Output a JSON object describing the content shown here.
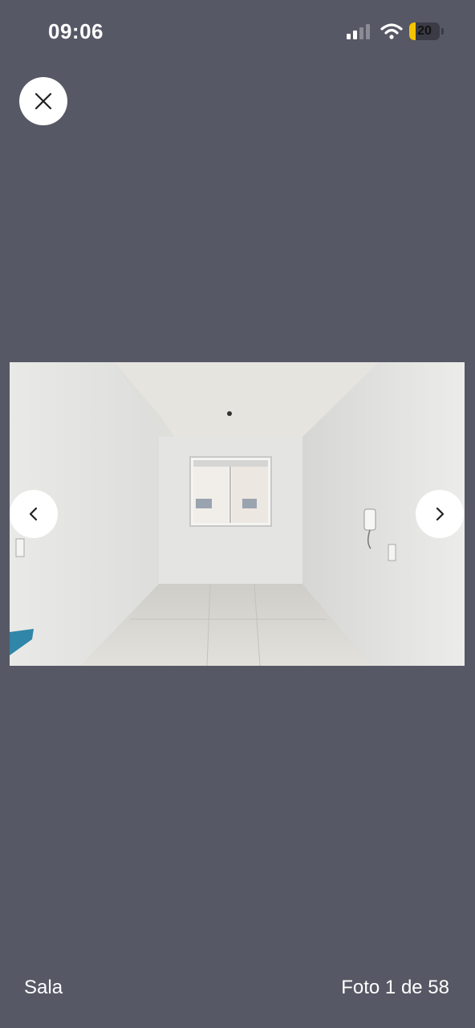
{
  "status_bar": {
    "time": "09:06",
    "battery_level": "20",
    "battery_color": "#f5c400",
    "icons": [
      "signal-icon",
      "wifi-icon",
      "battery-icon"
    ]
  },
  "viewer": {
    "background_color": "#575865",
    "close_icon": "close-icon",
    "prev_icon": "chevron-left-icon",
    "next_icon": "chevron-right-icon"
  },
  "photo": {
    "caption": "Sala",
    "counter": "Foto 1 de 58",
    "current_index": 1,
    "total": 58
  }
}
